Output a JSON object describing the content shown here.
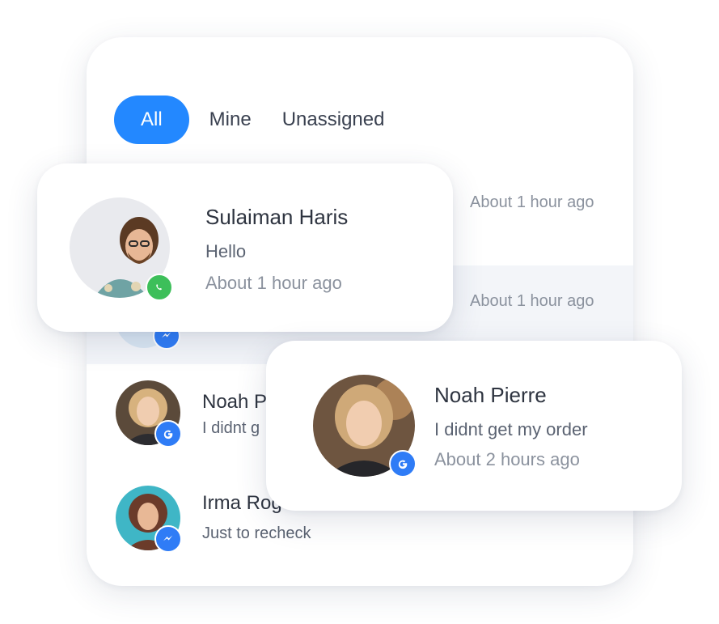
{
  "tabs": [
    {
      "label": "All",
      "active": true
    },
    {
      "label": "Mine",
      "active": false
    },
    {
      "label": "Unassigned",
      "active": false
    }
  ],
  "panel": {
    "row_times": [
      "About 1 hour ago",
      "About 1 hour ago"
    ],
    "rows": [
      {
        "name": "Noah P",
        "message": "I didnt g",
        "channel": "google-icon"
      },
      {
        "name": "Irma Rogers",
        "message": "Just to recheck",
        "channel": "messenger-icon"
      }
    ]
  },
  "cards": {
    "sulaiman": {
      "name": "Sulaiman Haris",
      "message": "Hello",
      "time": "About 1 hour ago",
      "channel": "whatsapp-icon"
    },
    "noah": {
      "name": "Noah Pierre",
      "message": "I didnt get my order",
      "time": "About 2 hours ago",
      "channel": "google-icon"
    }
  },
  "colors": {
    "accent": "#2388ff",
    "whatsapp": "#3dbf5a",
    "messenger": "#2f7cf6",
    "google": "#2f7cf6",
    "highlight_row": "#f3f5f9"
  }
}
